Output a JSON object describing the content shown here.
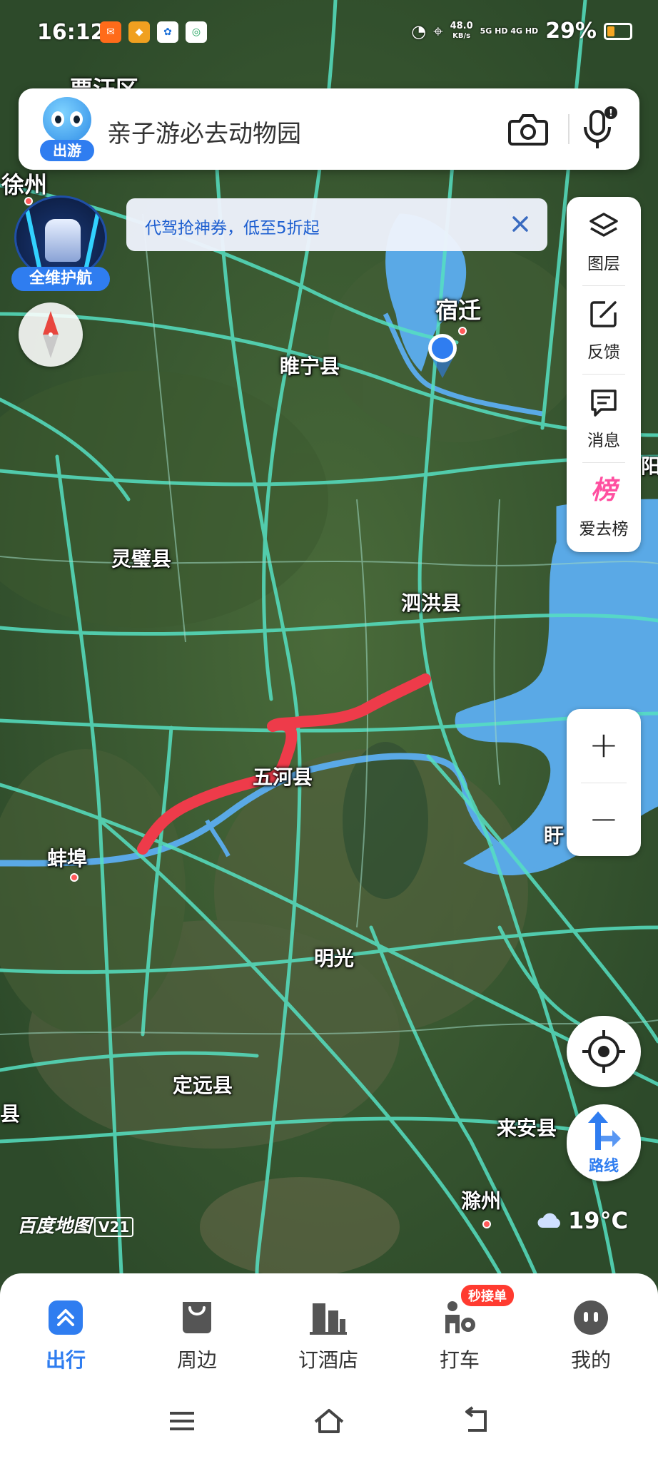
{
  "status_bar": {
    "time": "16:12",
    "network_speed": "48.0",
    "network_speed_unit": "KB/s",
    "network_types": "5G HD  4G HD",
    "battery_percent": "29%"
  },
  "search": {
    "mascot_badge": "出游",
    "query_text": "亲子游必去动物园",
    "camera_icon": "camera-icon",
    "mic_icon": "microphone-icon"
  },
  "nav_guard": {
    "label": "全维护航"
  },
  "promo": {
    "text": "代驾抢神券，低至5折起"
  },
  "right_tools": [
    {
      "label": "图层",
      "icon": "layers-icon"
    },
    {
      "label": "反馈",
      "icon": "feedback-edit-icon"
    },
    {
      "label": "消息",
      "icon": "message-icon"
    },
    {
      "label": "爱去榜",
      "icon": "ranking-icon",
      "icon_text": "榜"
    }
  ],
  "zoom": {
    "in": "+",
    "out": "−"
  },
  "route_button": {
    "label": "路线"
  },
  "map": {
    "places": [
      {
        "name": "贾汪区"
      },
      {
        "name": "徐州"
      },
      {
        "name": "宿迁"
      },
      {
        "name": "睢宁县"
      },
      {
        "name": "灵璧县"
      },
      {
        "name": "泗洪县"
      },
      {
        "name": "五河县"
      },
      {
        "name": "蚌埠"
      },
      {
        "name": "明光"
      },
      {
        "name": "定远县"
      },
      {
        "name": "来安县"
      },
      {
        "name": "滁州"
      },
      {
        "name": "阳"
      },
      {
        "name": "盱"
      },
      {
        "name": "县"
      }
    ],
    "logo_text": "百度地图",
    "logo_version": "V21",
    "colors": {
      "road": "#56e0c2",
      "water": "#5aa9e6",
      "route": "#ee3b4a",
      "land": "#3d5c33"
    }
  },
  "weather": {
    "temperature": "19°C",
    "icon": "cloud-icon"
  },
  "tabbar": {
    "tabs": [
      {
        "label": "出行",
        "active": true,
        "icon": "travel-icon"
      },
      {
        "label": "周边",
        "active": false,
        "icon": "nearby-icon"
      },
      {
        "label": "订酒店",
        "active": false,
        "icon": "hotel-icon"
      },
      {
        "label": "打车",
        "active": false,
        "icon": "taxi-icon",
        "badge": "秒接单"
      },
      {
        "label": "我的",
        "active": false,
        "icon": "profile-icon"
      }
    ]
  },
  "system_nav": {
    "menu": "menu-icon",
    "home": "home-icon",
    "back": "back-icon"
  }
}
